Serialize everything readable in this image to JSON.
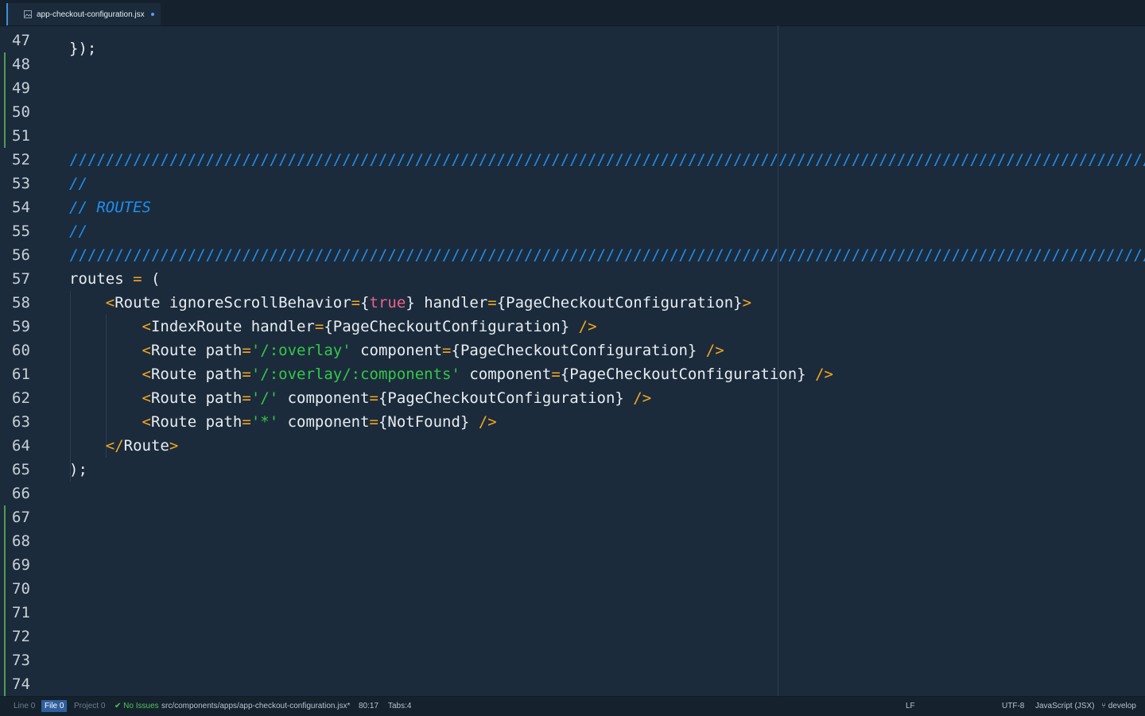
{
  "tab": {
    "filename": "app-checkout-configuration.jsx",
    "icon": "file-image-icon",
    "modified": true
  },
  "editor": {
    "partial_top_text": "});",
    "lines": [
      {
        "n": "47",
        "html": ""
      },
      {
        "n": "48",
        "html": ""
      },
      {
        "n": "49",
        "html": ""
      },
      {
        "n": "50",
        "html": ""
      },
      {
        "n": "51",
        "html": ""
      },
      {
        "n": "52",
        "html": "<span class=\"c-cmt-hash\">/////////////////////////////////////////////////////////////////////////////////////////////////////////////////////////////</span>"
      },
      {
        "n": "53",
        "html": "<span class=\"c-cmt\">//</span>"
      },
      {
        "n": "54",
        "html": "<span class=\"c-cmt\">// ROUTES</span>"
      },
      {
        "n": "55",
        "html": "<span class=\"c-cmt\">//</span>"
      },
      {
        "n": "56",
        "html": "<span class=\"c-cmt-hash\">/////////////////////////////////////////////////////////////////////////////////////////////////////////////////////////////</span>"
      },
      {
        "n": "57",
        "html": "routes <span class=\"c-punc\">=</span> ("
      },
      {
        "n": "58",
        "html": "    <span class=\"c-punc\">&lt;</span>Route ignoreScrollBehavior<span class=\"c-punc\">=</span>{<span class=\"c-bool\">true</span>} handler<span class=\"c-punc\">=</span>{PageCheckoutConfiguration}<span class=\"c-punc\">&gt;</span>"
      },
      {
        "n": "59",
        "html": "        <span class=\"c-punc\">&lt;</span>IndexRoute handler<span class=\"c-punc\">=</span>{PageCheckoutConfiguration} <span class=\"c-punc\">/&gt;</span>"
      },
      {
        "n": "60",
        "html": "        <span class=\"c-punc\">&lt;</span>Route path<span class=\"c-punc\">=</span><span class=\"c-str\">'/:overlay'</span> component<span class=\"c-punc\">=</span>{PageCheckoutConfiguration} <span class=\"c-punc\">/&gt;</span>"
      },
      {
        "n": "61",
        "html": "        <span class=\"c-punc\">&lt;</span>Route path<span class=\"c-punc\">=</span><span class=\"c-str\">'/:overlay/:components'</span> component<span class=\"c-punc\">=</span>{PageCheckoutConfiguration} <span class=\"c-punc\">/&gt;</span>"
      },
      {
        "n": "62",
        "html": "        <span class=\"c-punc\">&lt;</span>Route path<span class=\"c-punc\">=</span><span class=\"c-str\">'/'</span> component<span class=\"c-punc\">=</span>{PageCheckoutConfiguration} <span class=\"c-punc\">/&gt;</span>"
      },
      {
        "n": "63",
        "html": "        <span class=\"c-punc\">&lt;</span>Route path<span class=\"c-punc\">=</span><span class=\"c-str\">'*'</span> component<span class=\"c-punc\">=</span>{NotFound} <span class=\"c-punc\">/&gt;</span>"
      },
      {
        "n": "64",
        "html": "    <span class=\"c-punc\">&lt;/</span>Route<span class=\"c-punc\">&gt;</span>"
      },
      {
        "n": "65",
        "html": ");"
      },
      {
        "n": "66",
        "html": ""
      },
      {
        "n": "67",
        "html": ""
      },
      {
        "n": "68",
        "html": ""
      },
      {
        "n": "69",
        "html": ""
      },
      {
        "n": "70",
        "html": ""
      },
      {
        "n": "71",
        "html": ""
      },
      {
        "n": "72",
        "html": ""
      },
      {
        "n": "73",
        "html": ""
      },
      {
        "n": "74",
        "html": ""
      }
    ]
  },
  "statusbar": {
    "line_label": "Line",
    "line_count": "0",
    "file_label": "File",
    "file_count": "0",
    "project_label": "Project",
    "project_count": "0",
    "issues": "No Issues",
    "path": "src/components/apps/app-checkout-configuration.jsx*",
    "cursor": "80:17",
    "tabs": "Tabs:4",
    "line_ending": "LF",
    "encoding": "UTF-8",
    "grammar": "JavaScript (JSX)",
    "branch": "develop"
  },
  "colors": {
    "background": "#1b2b3b",
    "comment": "#1f8ff0",
    "punctuation": "#f4a620",
    "string": "#34c74a",
    "boolean": "#f0618d",
    "git_added": "#4d9e52"
  }
}
